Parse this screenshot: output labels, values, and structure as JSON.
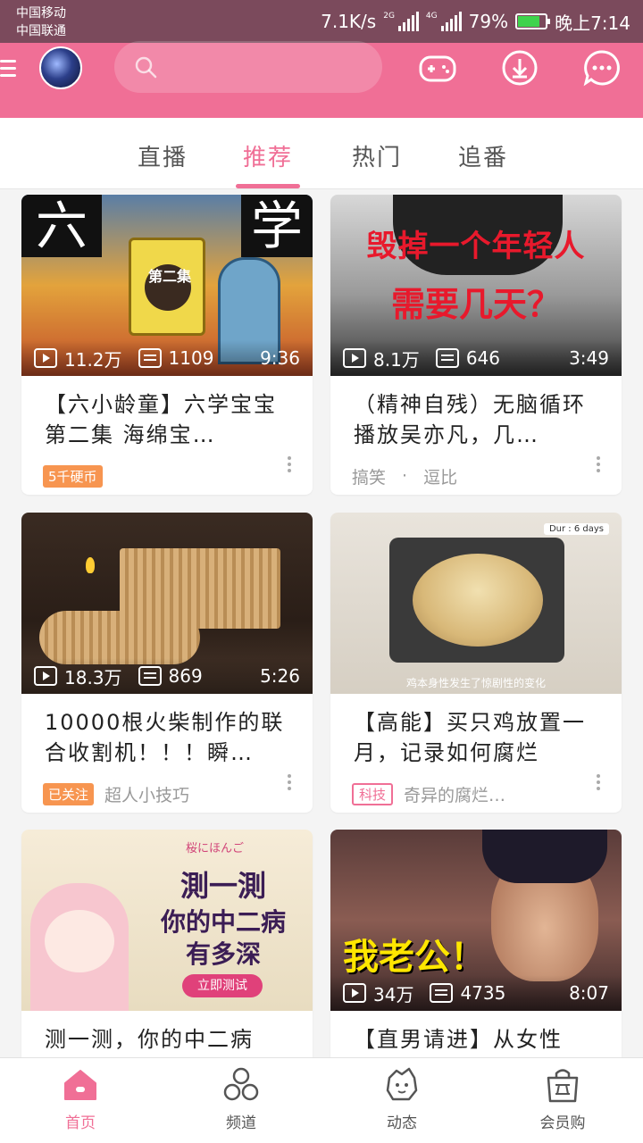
{
  "status_bar": {
    "carrier_1": "中国移动",
    "carrier_2": "中国联通",
    "speed": "7.1K/s",
    "net_1": "2G",
    "net_2": "4G",
    "battery": "79%",
    "battery_level": 0.79,
    "time": "晚上7:14"
  },
  "header": {
    "search_placeholder": "",
    "icons": [
      "menu-icon",
      "avatar",
      "search-icon",
      "gamepad-icon",
      "download-icon",
      "message-icon"
    ]
  },
  "tabs": [
    {
      "label": "直播"
    },
    {
      "label": "推荐",
      "active": true
    },
    {
      "label": "热门"
    },
    {
      "label": "追番"
    }
  ],
  "cards": [
    {
      "plays": "11.2万",
      "danmaku": "1109",
      "duration": "9:36",
      "title": "【六小龄童】六学宝宝 第二集 海绵宝…",
      "badge": "5千硬币",
      "tag": "",
      "category": "",
      "thumb_text_1": "六",
      "thumb_text_2": "学",
      "thumb_text_3": "第二集"
    },
    {
      "plays": "8.1万",
      "danmaku": "646",
      "duration": "3:49",
      "title": "（精神自残）无脑循环播放吴亦凡，几…",
      "badge": "",
      "tag": "搞笑",
      "category": "逗比",
      "thumb_text_1": "毁掉一个年轻人",
      "thumb_text_2": "需要几天？"
    },
    {
      "plays": "18.3万",
      "danmaku": "869",
      "duration": "5:26",
      "title": "10000根火柴制作的联合收割机！！！瞬…",
      "badge": "已关注",
      "tag": "超人小技巧",
      "category": ""
    },
    {
      "plays": "",
      "danmaku": "",
      "duration": "",
      "title": "【高能】买只鸡放置一月，记录如何腐烂",
      "badge": "科技",
      "tag": "奇异的腐烂…",
      "category": "",
      "thumb_text_1": "Dur : 6 days",
      "thumb_text_2": "鸡本身性发生了惊剧性的变化"
    },
    {
      "plays": "",
      "danmaku": "",
      "duration": "",
      "title": "测一测，你的中二病",
      "badge": "",
      "tag": "",
      "category": "",
      "thumb_text_1": "測一測",
      "thumb_text_2": "你的中二病",
      "thumb_text_3": "有多深",
      "thumb_text_4": "立即测试",
      "thumb_text_5": "桜にほんご"
    },
    {
      "plays": "34万",
      "danmaku": "4735",
      "duration": "8:07",
      "title": "【直男请进】从女性",
      "badge": "",
      "tag": "",
      "category": "",
      "thumb_text_1": "我老公！"
    }
  ],
  "bottom_nav": [
    {
      "label": "首页",
      "active": true
    },
    {
      "label": "频道"
    },
    {
      "label": "动态"
    },
    {
      "label": "会员购"
    }
  ],
  "colors": {
    "primary": "#f06f96",
    "status_bar": "#7b4a5c",
    "badge_orange": "#f79550"
  }
}
